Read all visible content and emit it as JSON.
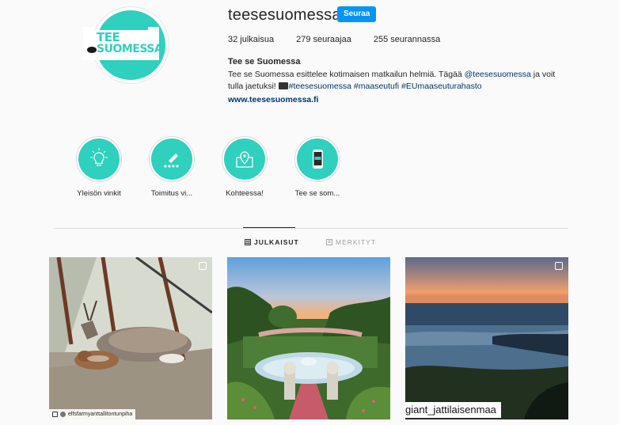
{
  "profile": {
    "username": "teesesuomessa",
    "follow_label": "Seuraa",
    "logo_line1": "TEE",
    "logo_line2": "SUOMESSA",
    "stats": {
      "posts": "32 julkaisua",
      "followers": "279 seuraajaa",
      "following": "255 seurannassa"
    },
    "bio_name": "Tee se Suomessa",
    "bio_line1_a": "Tee se Suomessa esittelee kotimaisen matkailun helmiä. Tägää ",
    "bio_mention": "@teesesuomessa",
    "bio_line1_b": " ja voit",
    "bio_line2_a": "tulla jaetuksi! ",
    "bio_hashtags": "#teesesuomessa #maaseutufi #EUmaaseuturahasto",
    "website": "www.teesesuomessa.fi"
  },
  "highlights": [
    {
      "label": "Yleisön vinkit",
      "icon": "lightbulb-icon"
    },
    {
      "label": "Toimitus vi...",
      "icon": "pencil-stars-icon"
    },
    {
      "label": "Kohteessa!",
      "icon": "map-pin-icon"
    },
    {
      "label": "Tee se som...",
      "icon": "phone-icon"
    }
  ],
  "tabs": [
    {
      "label": "JULKAISUT",
      "icon": "grid-icon",
      "active": true
    },
    {
      "label": "MERKITYT",
      "icon": "tagged-icon",
      "active": false
    }
  ],
  "posts": [
    {
      "overlay": "elfsfarmyanttallitontunpiha",
      "kind": "deer"
    },
    {
      "overlay": "",
      "kind": "garden"
    },
    {
      "overlay": "giant_jattilaisenmaa",
      "kind": "sunset"
    }
  ],
  "colors": {
    "brand": "#2fd0be",
    "link": "#00376b",
    "button": "#0095f6"
  }
}
